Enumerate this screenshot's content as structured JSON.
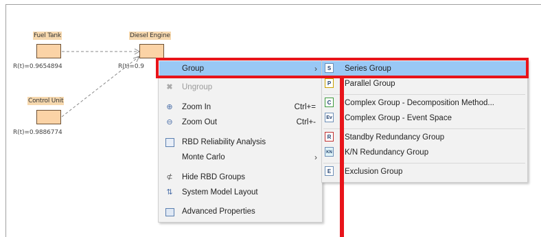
{
  "diagram": {
    "blocks": [
      {
        "name": "Fuel Tank"
      },
      {
        "name": "Diesel Engine"
      },
      {
        "name": "Control Unit"
      }
    ],
    "reliabilities": [
      "R(t)=0.9654894",
      "R(t)=0.9",
      "R(t)=0.9886774"
    ]
  },
  "context_menu": {
    "items": [
      {
        "label": "Group",
        "icon": "",
        "shortcut": "",
        "arrow": "›"
      },
      {
        "label": "Ungroup",
        "icon": "close-icon",
        "shortcut": "",
        "arrow": ""
      },
      {
        "label": "Zoom In",
        "icon": "zoom-in-icon",
        "shortcut": "Ctrl+=",
        "arrow": ""
      },
      {
        "label": "Zoom Out",
        "icon": "zoom-out-icon",
        "shortcut": "Ctrl+-",
        "arrow": ""
      },
      {
        "label": "RBD Reliability Analysis",
        "icon": "analysis-icon",
        "shortcut": "",
        "arrow": ""
      },
      {
        "label": "Monte Carlo",
        "icon": "",
        "shortcut": "",
        "arrow": "›"
      },
      {
        "label": "Hide RBD Groups",
        "icon": "hide-groups-icon",
        "shortcut": "",
        "arrow": ""
      },
      {
        "label": "System Model Layout",
        "icon": "layout-icon",
        "shortcut": "",
        "arrow": ""
      },
      {
        "label": "Advanced Properties",
        "icon": "properties-icon",
        "shortcut": "",
        "arrow": ""
      }
    ]
  },
  "submenu": {
    "items": [
      {
        "label": "Series Group",
        "icon_text": "S"
      },
      {
        "label": "Parallel Group",
        "icon_text": "P"
      },
      {
        "label": "Complex Group - Decomposition Method...",
        "icon_text": "C"
      },
      {
        "label": "Complex Group - Event Space",
        "icon_text": "Ev"
      },
      {
        "label": "Standby Redundancy Group",
        "icon_text": "R"
      },
      {
        "label": "K/N Redundancy Group",
        "icon_text": "KN"
      },
      {
        "label": "Exclusion Group",
        "icon_text": "E"
      }
    ]
  },
  "colors": {
    "highlight": "#99c8f5",
    "annotation_red": "#e8141a",
    "block_fill": "#fbd3a6"
  }
}
